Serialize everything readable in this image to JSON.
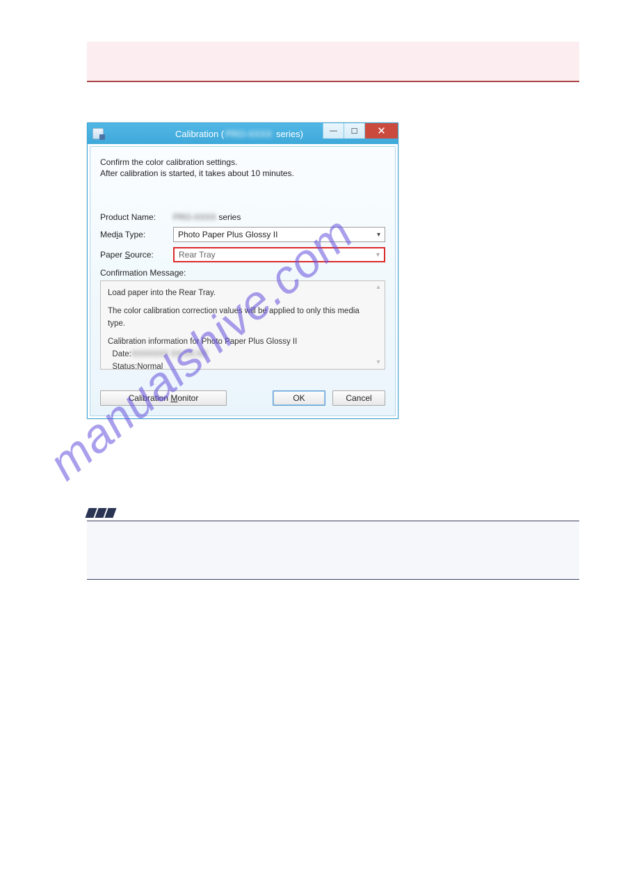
{
  "watermark_text": "manualshive.com",
  "dialog": {
    "title_prefix": "Calibration (",
    "title_blur": "PRO-XXXX",
    "title_suffix": " series)",
    "intro_line1": "Confirm the color calibration settings.",
    "intro_line2": "After calibration is started, it takes about 10 minutes.",
    "product_name_label": "Product Name:",
    "product_name_blur": "PRO-XXXX",
    "product_name_suffix": " series",
    "media_type_label": "Media Type:",
    "media_type_value": "Photo Paper Plus Glossy II",
    "paper_source_label": "Paper Source:",
    "paper_source_value": "Rear Tray",
    "confirmation_label": "Confirmation Message:",
    "msg_line1": "Load paper into the Rear Tray.",
    "msg_line2": "The color calibration correction values will be applied to only this media type.",
    "msg_line3": "Calibration information for Photo Paper Plus Glossy II",
    "msg_date_label": "Date:",
    "msg_date_blur": "XXXXXXX XX:XX:XX",
    "msg_status": "Status:Normal",
    "calibration_monitor": "Calibration Monitor",
    "ok": "OK",
    "cancel": "Cancel"
  }
}
